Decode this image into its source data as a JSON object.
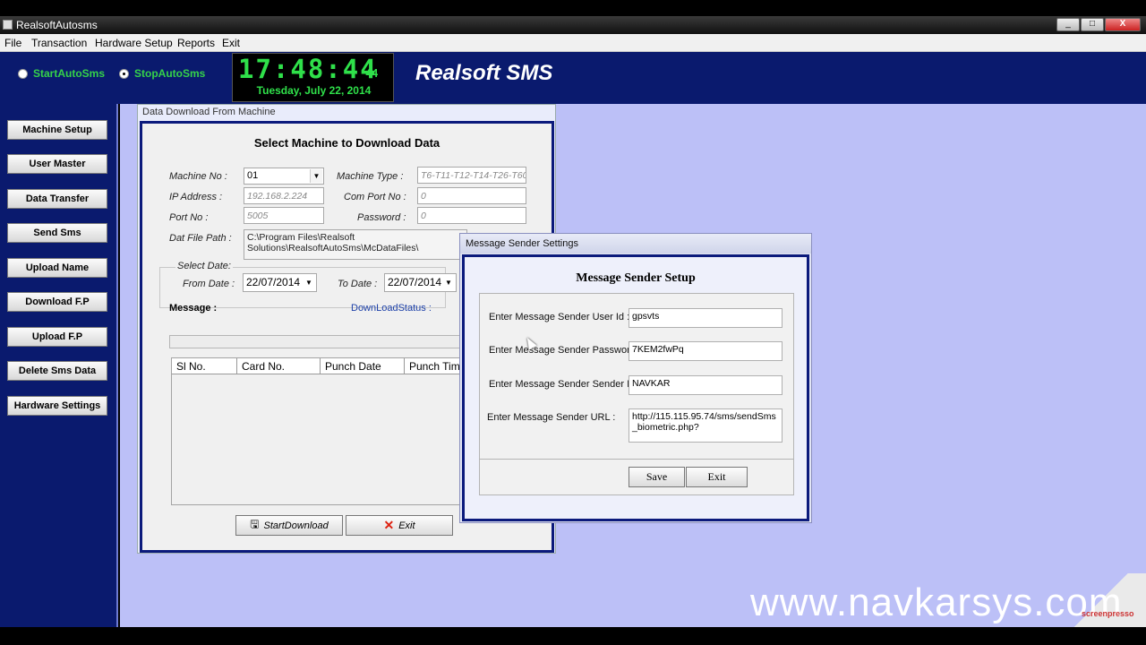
{
  "window": {
    "title": "RealsoftAutosms",
    "min": "_",
    "max": "□",
    "close": "X"
  },
  "menu": [
    "File",
    "Transaction",
    "Hardware Setup",
    "Reports",
    "Exit"
  ],
  "top": {
    "start_auto": "StartAutoSms",
    "stop_auto": "StopAutoSms",
    "selected": "StopAutoSms",
    "clock_time": "17:48:44",
    "clock_seconds": "44",
    "clock_date": "Tuesday, July 22, 2014",
    "brand": "Realsoft SMS"
  },
  "sidebar": [
    "Machine Setup",
    "User Master",
    "Data Transfer",
    "Send Sms",
    "Upload Name",
    "Download F.P",
    "Upload F.P",
    "Delete Sms Data",
    "Hardware Settings"
  ],
  "download": {
    "caption": "Data Download From Machine",
    "heading": "Select Machine to Download Data",
    "machine_no_label": "Machine No :",
    "machine_no": "01",
    "machine_type_label": "Machine Type :",
    "machine_type": "T6-T11-T12-T14-T26-T60",
    "ip_label": "IP Address :",
    "ip": "192.168.2.224",
    "com_label": "Com Port No :",
    "com": "0",
    "port_label": "Port No :",
    "port": "5005",
    "password_label": "Password :",
    "password": "0",
    "dat_label": "Dat File Path :",
    "dat_path_1": "C:\\Program Files\\Realsoft",
    "dat_path_2": "Solutions\\RealsoftAutoSms\\McDataFiles\\",
    "select_date": "Select Date:",
    "from_label": "From Date :",
    "from_date": "22/07/2014",
    "to_label": "To Date :",
    "to_date": "22/07/2014",
    "message_label": "Message :",
    "status_label": "DownLoadStatus :",
    "columns": [
      "Sl No.",
      "Card No.",
      "Punch Date",
      "Punch Time"
    ],
    "start_btn": "StartDownload",
    "exit_btn": "Exit"
  },
  "sender": {
    "caption": "Message Sender Settings",
    "heading": "Message Sender Setup",
    "user_label": "Enter Message Sender User Id :",
    "user": "gpsvts",
    "pass_label": "Enter Message Sender Password :",
    "pass": "7KEM2fwPq",
    "sender_label": "Enter Message Sender Sender Id :",
    "sender": "NAVKAR",
    "url_label": "Enter Message Sender URL :",
    "url": "http://115.115.95.74/sms/sendSms_biometric.php?",
    "save": "Save",
    "exit": "Exit"
  },
  "watermark": "www.navkarsys.com",
  "sp_logo": "screenpresso",
  "colors": {
    "navy": "#0a1a6e",
    "green": "#35d24a",
    "lavender": "#bcc0f7",
    "frame": "#0b1a7c"
  }
}
